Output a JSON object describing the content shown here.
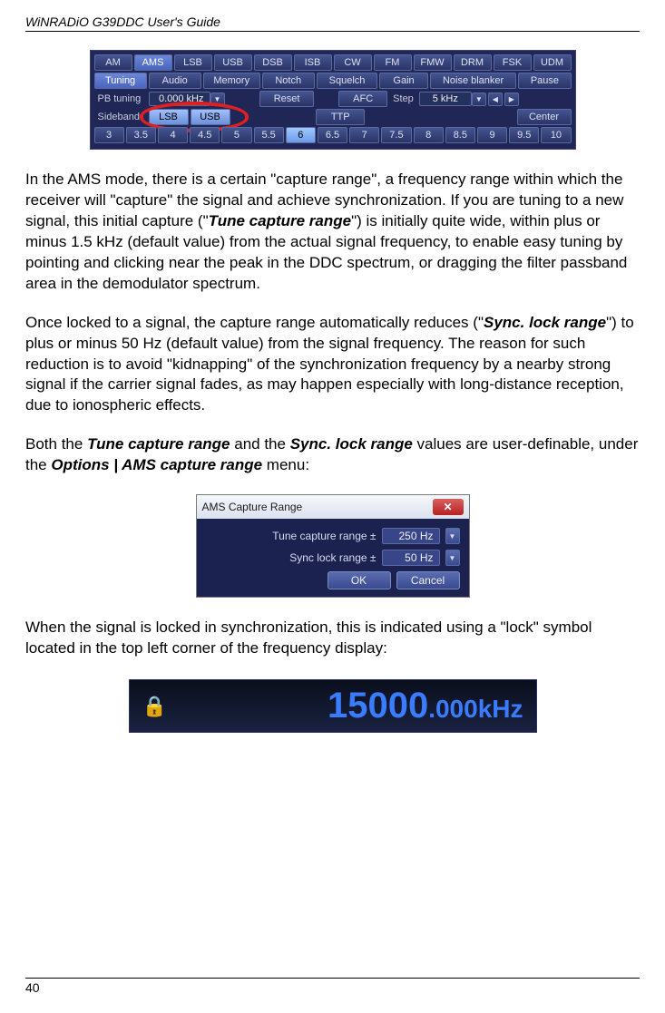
{
  "header": {
    "title": "WiNRADiO G39DDC User's Guide"
  },
  "panel1": {
    "modes": [
      "AM",
      "AMS",
      "LSB",
      "USB",
      "DSB",
      "ISB",
      "CW",
      "FM",
      "FMW",
      "DRM",
      "FSK",
      "UDM"
    ],
    "mode_selected_index": 1,
    "tabs": [
      "Tuning",
      "Audio",
      "Memory",
      "Notch",
      "Squelch",
      "Gain",
      "Noise blanker",
      "Pause"
    ],
    "tab_selected_index": 0,
    "row3": {
      "pb_tuning_label": "PB tuning",
      "pb_tuning_value": "0.000 kHz",
      "reset_label": "Reset",
      "afc_label": "AFC",
      "step_label": "Step",
      "step_value": "5 kHz"
    },
    "row4": {
      "sideband_label": "Sideband",
      "lsb_label": "LSB",
      "usb_label": "USB",
      "ttp_label": "TTP",
      "center_label": "Center"
    },
    "bw_values": [
      "3",
      "3.5",
      "4",
      "4.5",
      "5",
      "5.5",
      "6",
      "6.5",
      "7",
      "7.5",
      "8",
      "8.5",
      "9",
      "9.5",
      "10"
    ],
    "bw_selected_index": 6
  },
  "para1_parts": {
    "a": "In the AMS mode, there is a certain \"capture range\", a frequency range within which the receiver will \"capture\" the signal and achieve synchronization. If you are tuning to a new signal, this initial capture (\"",
    "b": "Tune capture range",
    "c": "\") is initially quite wide, within plus or minus 1.5 kHz (default value) from the actual signal frequency, to enable easy tuning by pointing and clicking near the peak in the DDC spectrum, or dragging the filter passband area in the demodulator spectrum."
  },
  "para2_parts": {
    "a": "Once locked to a signal, the capture range automatically reduces (\"",
    "b": "Sync. lock range",
    "c": "\") to plus or minus 50 Hz (default value) from the signal frequency. The reason for such reduction is to avoid \"kidnapping\" of the synchronization frequency by a nearby strong signal if the carrier signal fades, as may happen especially with long-distance reception, due to ionospheric effects."
  },
  "para3_parts": {
    "a": "Both the ",
    "b": "Tune capture range",
    "c": " and the ",
    "d": "Sync. lock range",
    "e": " values are user-definable, under the ",
    "f": "Options | AMS capture range",
    "g": " menu:"
  },
  "dialog": {
    "title": "AMS Capture Range",
    "tune_label": "Tune capture range ±",
    "tune_value": "250 Hz",
    "sync_label": "Sync lock range ±",
    "sync_value": "50 Hz",
    "ok_label": "OK",
    "cancel_label": "Cancel"
  },
  "para4": "When the signal is locked in synchronization, this is indicated using a \"lock\" symbol located in the top left corner of the frequency display:",
  "freq": {
    "lock_glyph": "🔒",
    "big": "15000",
    "small": ".000",
    "unit": "kHz"
  },
  "footer": {
    "page_number": "40"
  }
}
